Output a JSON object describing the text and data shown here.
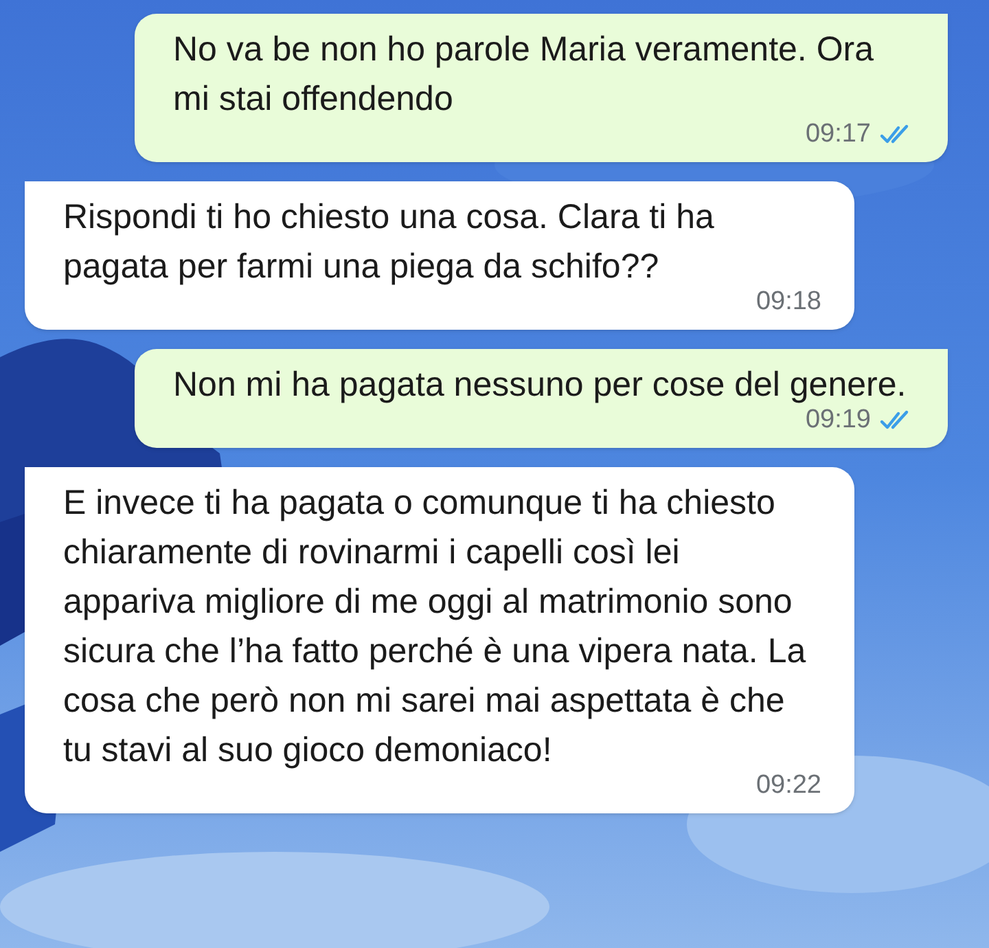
{
  "messages": [
    {
      "kind": "outgoing",
      "text": "No va be non ho parole Maria veramente. Ora mi stai offendendo",
      "time": "09:17",
      "read": true
    },
    {
      "kind": "incoming",
      "text": "Rispondi ti ho chiesto una cosa. Clara ti ha pagata per farmi una piega da schifo??",
      "time": "09:18"
    },
    {
      "kind": "outgoing",
      "text": "Non mi ha pagata nessuno per cose del genere.",
      "time": "09:19",
      "read": true
    },
    {
      "kind": "incoming",
      "text": "E invece ti ha pagata o comunque ti ha chiesto chiaramente di rovinarmi i capelli così lei appariva migliore di me oggi al matrimonio sono sicura che l’ha fatto perché è una vipera nata. La cosa che però non mi sarei mai aspettata è che tu stavi al suo gioco demoniaco!",
      "time": "09:22"
    }
  ]
}
